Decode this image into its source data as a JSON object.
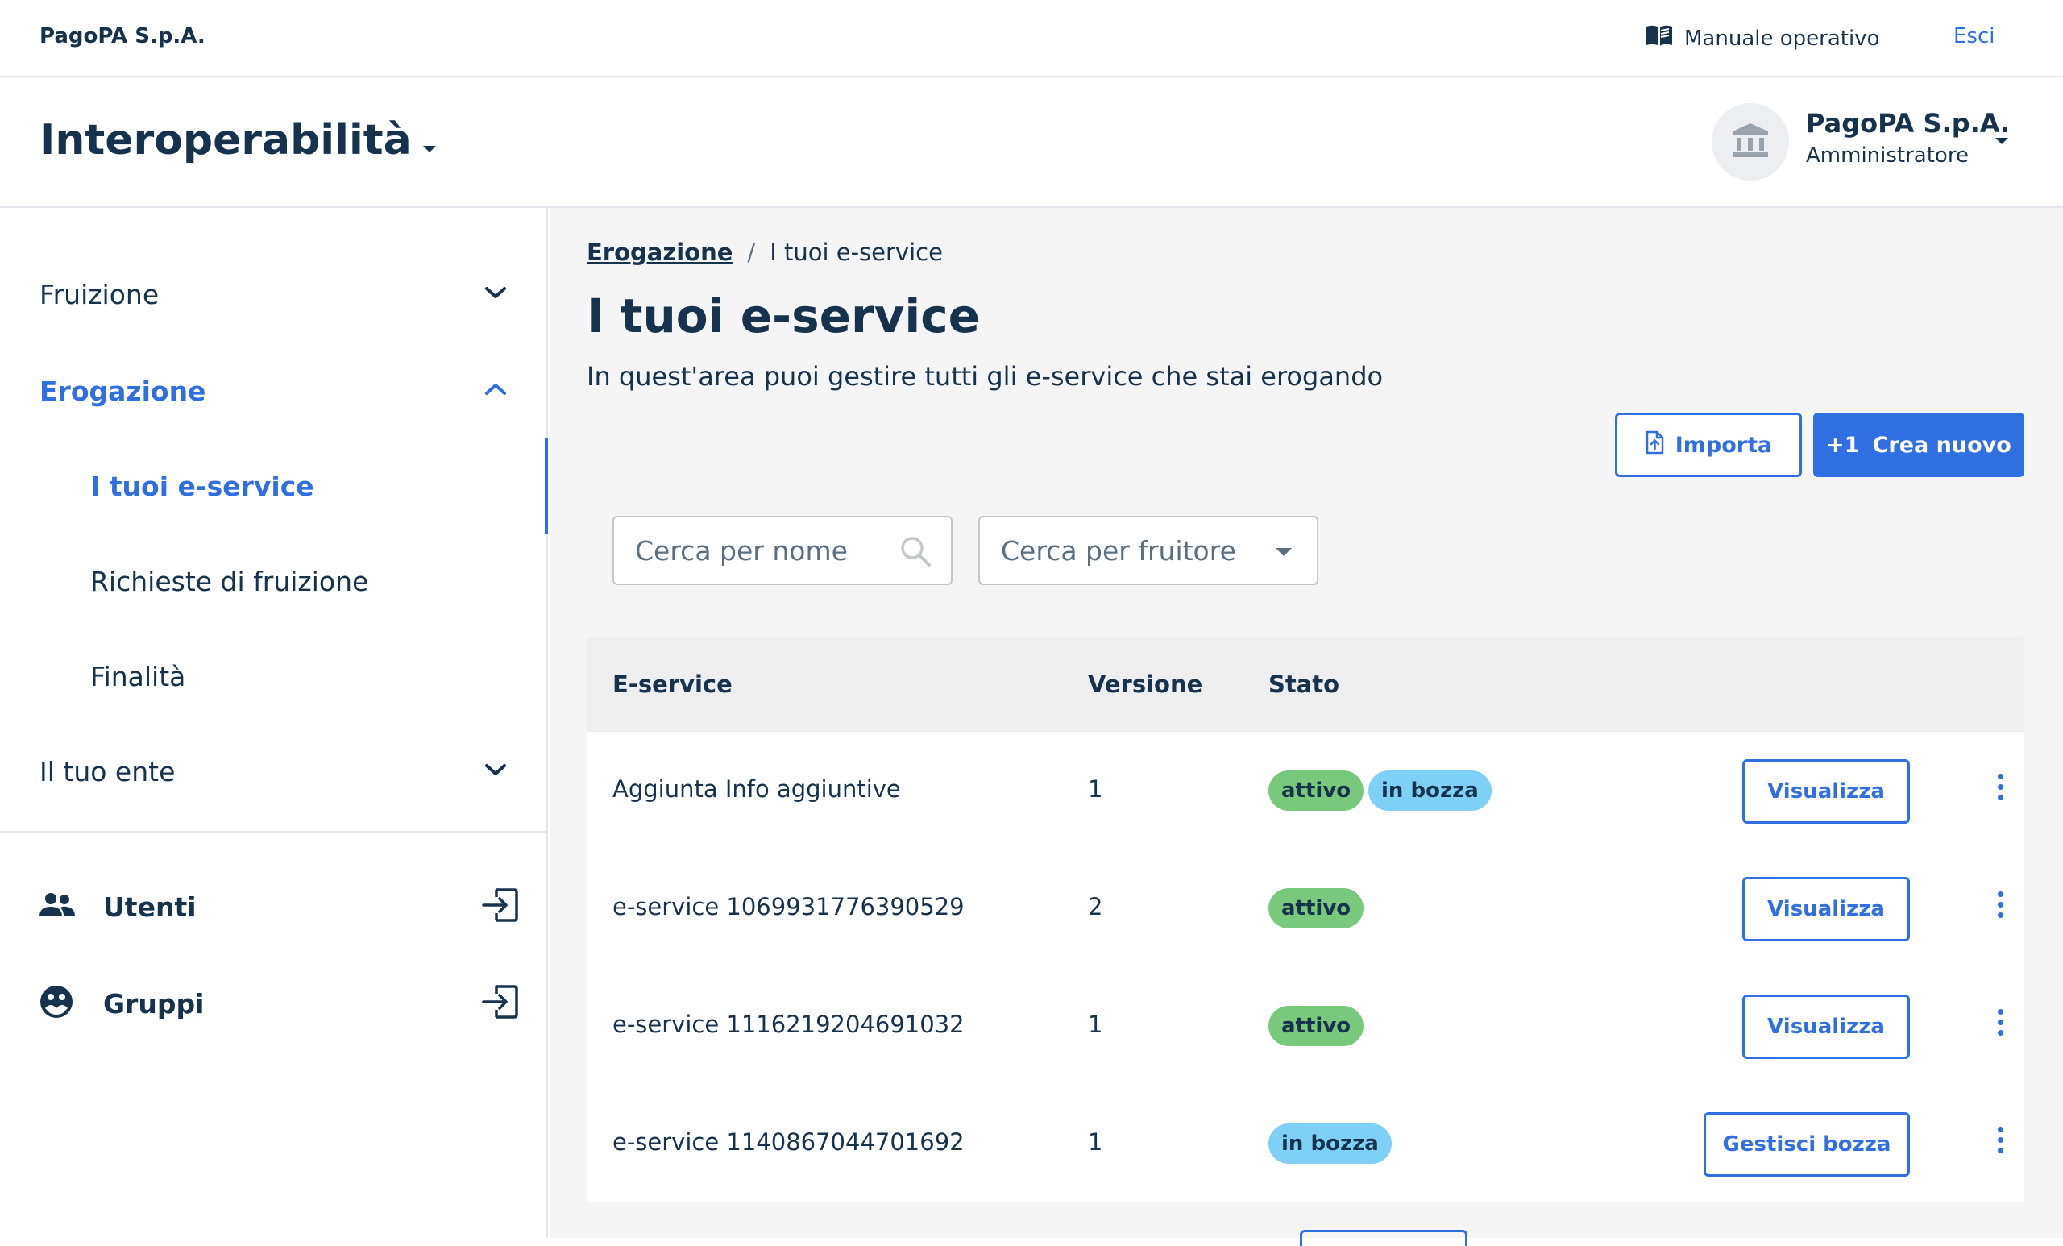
{
  "topbar": {
    "org_name": "PagoPA S.p.A.",
    "manual_label": "Manuale operativo",
    "manual_icon": "book-open-icon",
    "exit_label": "Esci"
  },
  "product": {
    "title": "Interoperabilità",
    "party_name": "PagoPA S.p.A.",
    "party_role": "Amministratore",
    "avatar_icon": "institution-icon"
  },
  "sidebar": {
    "items": [
      {
        "label": "Fruizione",
        "expanded": false
      },
      {
        "label": "Erogazione",
        "expanded": true
      },
      {
        "label": "Il tuo ente",
        "expanded": false
      }
    ],
    "subitems": [
      {
        "label": "I tuoi e-service",
        "selected": true
      },
      {
        "label": "Richieste di fruizione",
        "selected": false
      },
      {
        "label": "Finalità",
        "selected": false
      }
    ],
    "external": [
      {
        "label": "Utenti",
        "icon": "people-icon"
      },
      {
        "label": "Gruppi",
        "icon": "group-icon"
      }
    ]
  },
  "breadcrumb": {
    "parent": "Erogazione",
    "separator": "/",
    "current": "I tuoi e-service"
  },
  "page": {
    "title": "I tuoi e-service",
    "description": "In quest'area puoi gestire tutti gli e-service che stai erogando"
  },
  "actions": {
    "import_label": "Importa",
    "new_label": "Crea nuovo",
    "new_prefix": "+1"
  },
  "filters": {
    "name_placeholder": "Cerca per nome",
    "consumer_placeholder": "Cerca per fruitore"
  },
  "table": {
    "columns": [
      "E-service",
      "Versione",
      "Stato"
    ],
    "rows": [
      {
        "name": "Aggiunta Info aggiuntive",
        "version": "1",
        "badges": [
          "attivo",
          "in bozza"
        ],
        "action": "Visualizza"
      },
      {
        "name": "e-service 1069931776390529",
        "version": "2",
        "badges": [
          "attivo"
        ],
        "action": "Visualizza"
      },
      {
        "name": "e-service 1116219204691032",
        "version": "1",
        "badges": [
          "attivo"
        ],
        "action": "Visualizza"
      },
      {
        "name": "e-service 1140867044701692",
        "version": "1",
        "badges": [
          "in bozza"
        ],
        "action": "Gestisci bozza"
      }
    ]
  },
  "colors": {
    "primary": "#2f6fe1",
    "text": "#17324d",
    "badge_active": "#79c97d",
    "badge_draft": "#7fd0f6"
  }
}
